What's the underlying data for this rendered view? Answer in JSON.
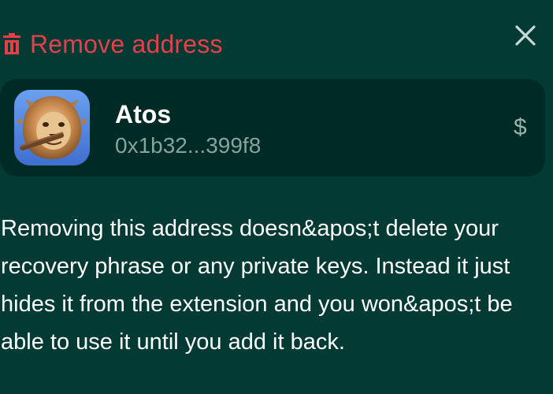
{
  "dialog": {
    "title": "Remove address",
    "title_color": "#e5404a",
    "title_icon": "trash-icon",
    "close_icon": "close-icon"
  },
  "account": {
    "name": "Atos",
    "address": "0x1b32...399f8",
    "currency_symbol": "$",
    "avatar": "lion-avatar"
  },
  "message": "Removing this address doesn&apos;t delete your recovery phrase or any private keys. Instead it just hides it from the extension and you won&apos;t be able to use it until you add it back."
}
